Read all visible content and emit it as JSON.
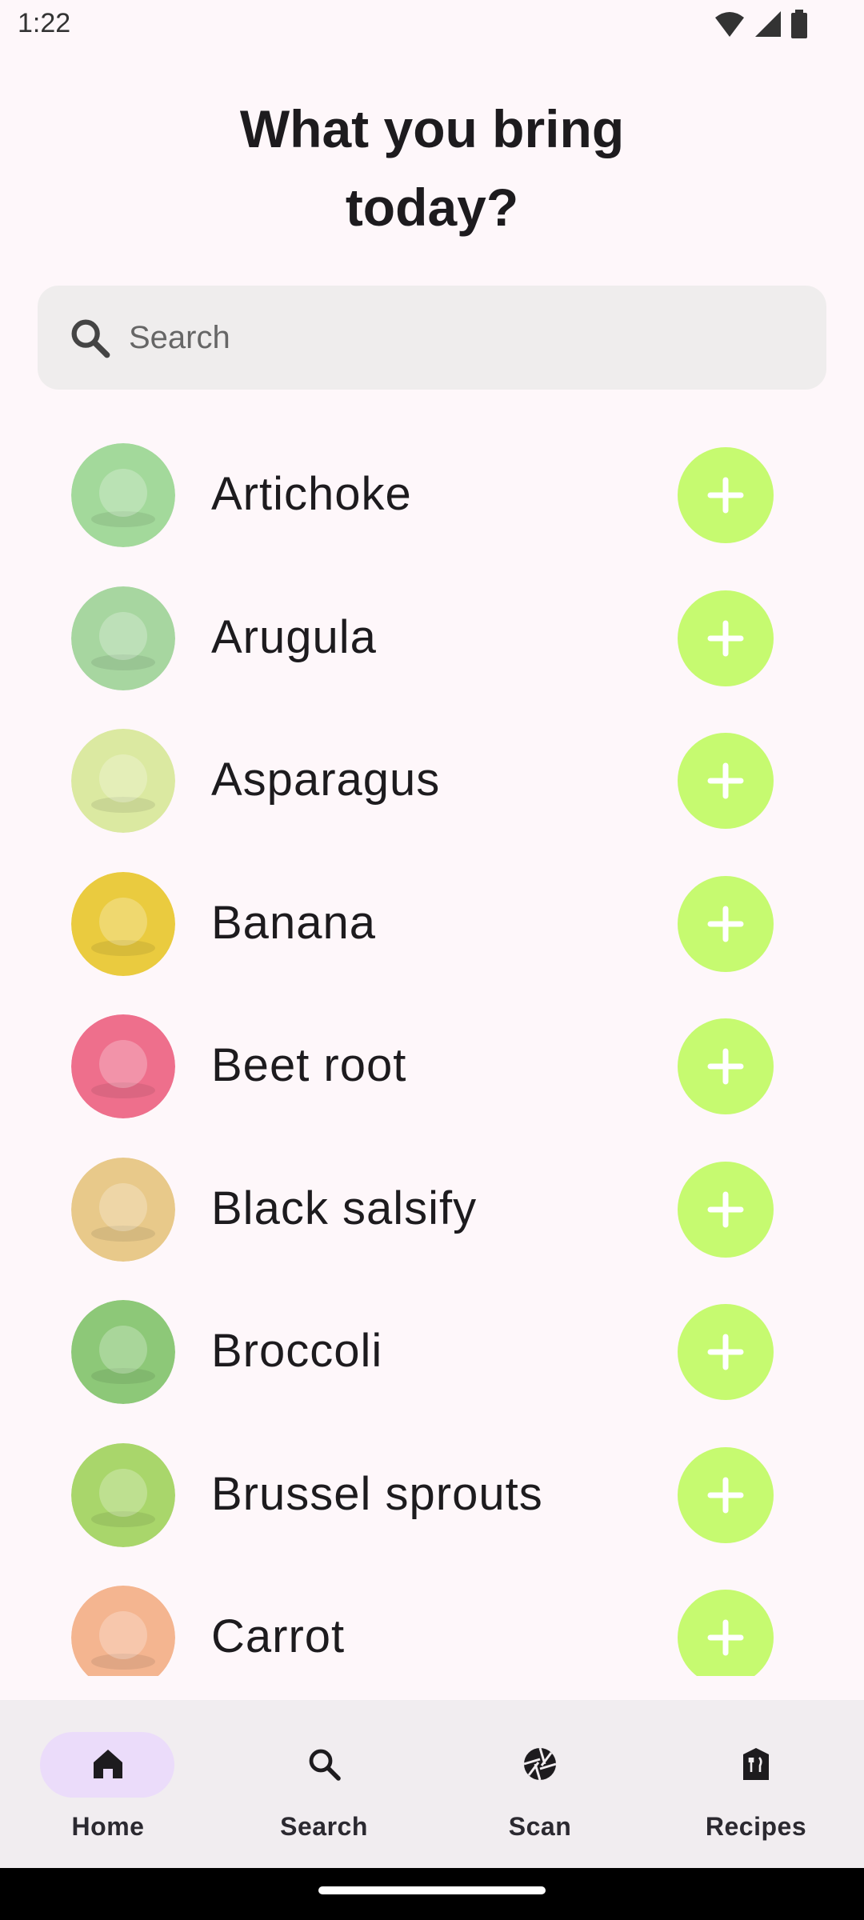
{
  "status_bar": {
    "time": "1:22",
    "icons": [
      "wifi-icon",
      "signal-icon",
      "battery-icon"
    ]
  },
  "title": {
    "line1": "What you bring",
    "line2": "today?"
  },
  "search": {
    "placeholder": "Search",
    "icon": "search-icon"
  },
  "items": [
    {
      "label": "Artichoke",
      "color": "#a3d99b"
    },
    {
      "label": "Arugula",
      "color": "#a7d6a0"
    },
    {
      "label": "Asparagus",
      "color": "#dbe9a1"
    },
    {
      "label": "Banana",
      "color": "#eacb3f"
    },
    {
      "label": "Beet root",
      "color": "#ee6f8c"
    },
    {
      "label": "Black salsify",
      "color": "#e8c98a"
    },
    {
      "label": "Broccoli",
      "color": "#8dc878"
    },
    {
      "label": "Brussel sprouts",
      "color": "#a9d66b"
    },
    {
      "label": "Carrot",
      "color": "#f4b590"
    }
  ],
  "colors": {
    "accent_add": "#c6fa70",
    "nav_active": "#ebdcfa",
    "background": "#fef7fa"
  },
  "bottom_nav": {
    "items": [
      {
        "label": "Home",
        "icon": "home-icon",
        "active": true
      },
      {
        "label": "Search",
        "icon": "search-icon",
        "active": false
      },
      {
        "label": "Scan",
        "icon": "camera-aperture-icon",
        "active": false
      },
      {
        "label": "Recipes",
        "icon": "recipes-icon",
        "active": false
      }
    ]
  }
}
